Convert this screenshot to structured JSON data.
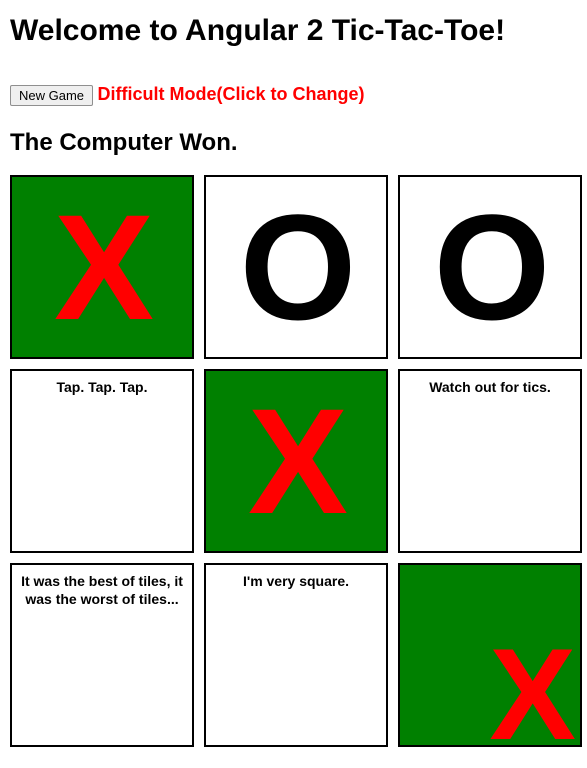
{
  "title": "Welcome to Angular 2 Tic-Tac-Toe!",
  "new_game_label": "New Game",
  "mode_text": "Difficult Mode(Click to Change)",
  "status_text": "The Computer Won.",
  "marks": {
    "x": "X",
    "o": "O"
  },
  "board": {
    "cells": [
      {
        "mark": "X",
        "green": true,
        "placeholder": ""
      },
      {
        "mark": "O",
        "green": false,
        "placeholder": ""
      },
      {
        "mark": "O",
        "green": false,
        "placeholder": ""
      },
      {
        "mark": "",
        "green": false,
        "placeholder": "Tap. Tap. Tap."
      },
      {
        "mark": "X",
        "green": true,
        "placeholder": ""
      },
      {
        "mark": "",
        "green": false,
        "placeholder": "Watch out for tics."
      },
      {
        "mark": "",
        "green": false,
        "placeholder": "It was the best of tiles, it was the worst of tiles..."
      },
      {
        "mark": "",
        "green": false,
        "placeholder": "I'm very square."
      },
      {
        "mark": "X",
        "green": true,
        "placeholder": "",
        "corner": true
      }
    ]
  }
}
